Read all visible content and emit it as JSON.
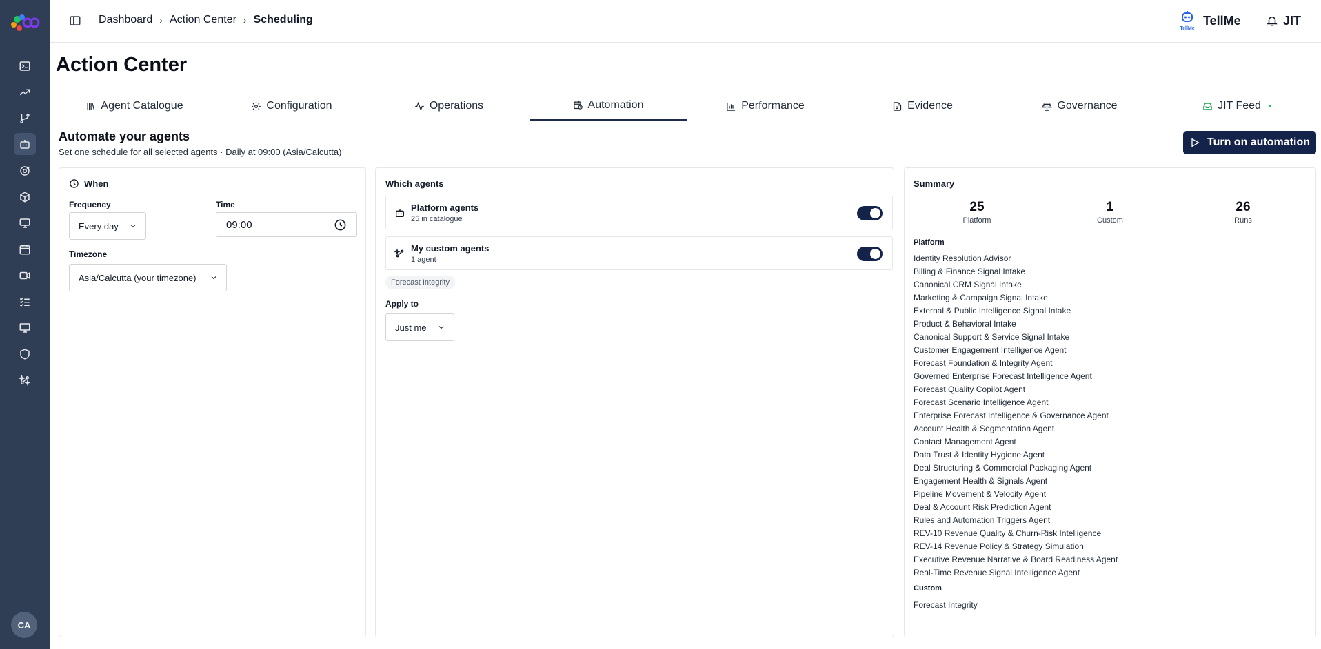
{
  "sidebar": {
    "items": [
      {
        "icon": "terminal-icon",
        "active": false
      },
      {
        "icon": "trending-up-icon",
        "active": false
      },
      {
        "icon": "git-branch-icon",
        "active": false
      },
      {
        "icon": "bot-icon",
        "active": true
      },
      {
        "icon": "orbit-icon",
        "active": false
      },
      {
        "icon": "box-icon",
        "active": false
      },
      {
        "icon": "monitor-icon",
        "active": false
      },
      {
        "icon": "calendar-icon",
        "active": false
      },
      {
        "icon": "video-icon",
        "active": false
      },
      {
        "icon": "list-checks-icon",
        "active": false
      },
      {
        "icon": "presentation-icon",
        "active": false
      },
      {
        "icon": "shield-icon",
        "active": false
      },
      {
        "icon": "sparkle-network-icon",
        "active": false
      }
    ],
    "avatar_initials": "CA"
  },
  "topbar": {
    "breadcrumb": [
      "Dashboard",
      "Action Center",
      "Scheduling"
    ],
    "tellme_label": "TellMe",
    "tellme_logo_text": "TellMe",
    "user_label": "JIT"
  },
  "page": {
    "title": "Action Center"
  },
  "tabs": [
    {
      "label": "Agent Catalogue",
      "icon": "library-icon",
      "active": false
    },
    {
      "label": "Configuration",
      "icon": "gear-icon",
      "active": false
    },
    {
      "label": "Operations",
      "icon": "activity-icon",
      "active": false
    },
    {
      "label": "Automation",
      "icon": "calendar-clock-icon",
      "active": true
    },
    {
      "label": "Performance",
      "icon": "bar-chart-icon",
      "active": false
    },
    {
      "label": "Evidence",
      "icon": "file-search-icon",
      "active": false
    },
    {
      "label": "Governance",
      "icon": "scale-icon",
      "active": false
    },
    {
      "label": "JIT Feed",
      "icon": "inbox-icon",
      "active": false,
      "status_dot": true
    }
  ],
  "automation": {
    "title": "Automate your agents",
    "subtitle": "Set one schedule for all selected agents · Daily at 09:00 (Asia/Calcutta)",
    "button_label": "Turn on automation"
  },
  "when": {
    "title": "When",
    "frequency_label": "Frequency",
    "frequency_value": "Every day",
    "time_label": "Time",
    "time_value": "09:00",
    "timezone_label": "Timezone",
    "timezone_value": "Asia/Calcutta (your timezone)"
  },
  "which": {
    "title": "Which agents",
    "platform": {
      "name": "Platform agents",
      "sub": "25 in catalogue",
      "enabled": true
    },
    "custom": {
      "name": "My custom agents",
      "sub": "1 agent",
      "enabled": true
    },
    "chip": "Forecast Integrity",
    "apply_label": "Apply to",
    "apply_value": "Just me"
  },
  "summary": {
    "title": "Summary",
    "stats": [
      {
        "value": "25",
        "label": "Platform"
      },
      {
        "value": "1",
        "label": "Custom"
      },
      {
        "value": "26",
        "label": "Runs"
      }
    ],
    "platform_heading": "Platform",
    "platform_agents": [
      "Identity Resolution Advisor",
      "Billing & Finance Signal Intake",
      "Canonical CRM Signal Intake",
      "Marketing & Campaign Signal Intake",
      "External & Public Intelligence Signal Intake",
      "Product & Behavioral Intake",
      "Canonical Support & Service Signal Intake",
      "Customer Engagement Intelligence Agent",
      "Forecast Foundation & Integrity Agent",
      "Governed Enterprise Forecast Intelligence Agent",
      "Forecast Quality Copilot Agent",
      "Forecast Scenario Intelligence Agent",
      "Enterprise Forecast Intelligence & Governance Agent",
      "Account Health & Segmentation Agent",
      "Contact Management Agent",
      "Data Trust & Identity Hygiene Agent",
      "Deal Structuring & Commercial Packaging Agent",
      "Engagement Health & Signals Agent",
      "Pipeline Movement & Velocity Agent",
      "Deal & Account Risk Prediction Agent",
      "Rules and Automation Triggers Agent",
      "REV-10 Revenue Quality & Churn-Risk Intelligence",
      "REV-14 Revenue Policy & Strategy Simulation",
      "Executive Revenue Narrative & Board Readiness Agent",
      "Real-Time Revenue Signal Intelligence Agent"
    ],
    "custom_heading": "Custom",
    "custom_agents": [
      "Forecast Integrity"
    ]
  },
  "colors": {
    "sidebar_bg": "#2f3e55",
    "primary": "#13234a",
    "active_tab_underline": "#1e2b4d",
    "status_green": "#22c55e"
  }
}
